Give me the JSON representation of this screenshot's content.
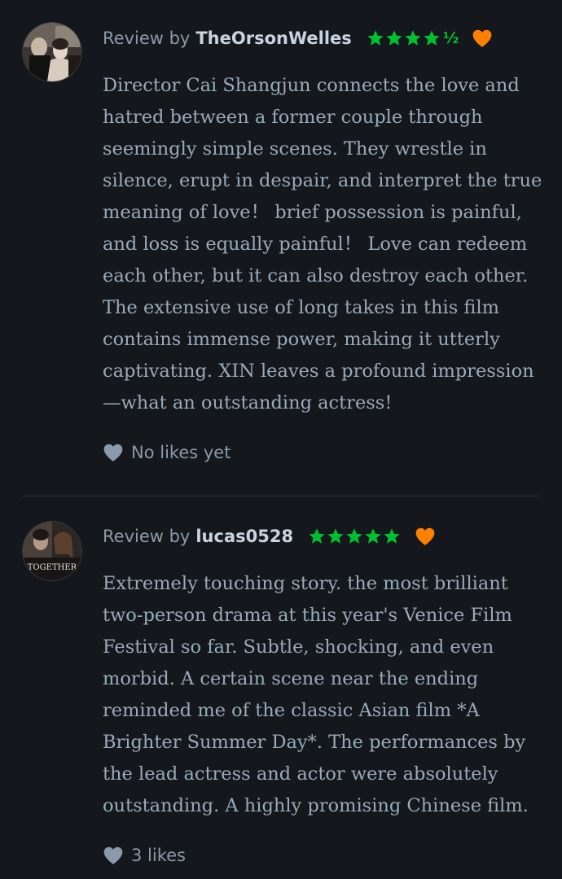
{
  "colors": {
    "background": "#14181c",
    "star_green": "#00c030",
    "liked_heart_orange": "#ff8000",
    "body_text": "#99aabb",
    "muted_text": "#8a9aab"
  },
  "reviews": [
    {
      "review_by_label": "Review by",
      "username": "TheOrsonWelles",
      "rating_stars": 4.5,
      "rating_half_glyph": "½",
      "liked_icon": "heart-icon",
      "body_lines": [
        "Director Cai Shangjun connects the love and",
        "hatred between a former couple through",
        "seemingly simple scenes. They wrestle in",
        "silence, erupt in despair, and interpret the true",
        "meaning of love！ brief possession is painful,",
        "and loss is equally painful！ Love can redeem",
        "each other, but it can also destroy each other.",
        "The extensive use of long takes in this film",
        "contains immense power, making it utterly",
        "captivating. XIN leaves a profound impression",
        "—what an outstanding actress!"
      ],
      "likes_label": "No likes yet"
    },
    {
      "review_by_label": "Review by",
      "username": "lucas0528",
      "rating_stars": 5,
      "liked_icon": "heart-icon",
      "avatar_text": "TOGETHER",
      "body_lines": [
        "Extremely touching story. the most brilliant",
        "two-person drama at this year's Venice Film",
        "Festival so far. Subtle, shocking, and even",
        "morbid. A certain scene near the ending",
        "reminded me of the classic Asian film *A",
        "Brighter Summer Day*. The performances by",
        "the lead actress and actor were absolutely",
        "outstanding. A highly promising Chinese film."
      ],
      "likes_label": "3 likes"
    }
  ]
}
